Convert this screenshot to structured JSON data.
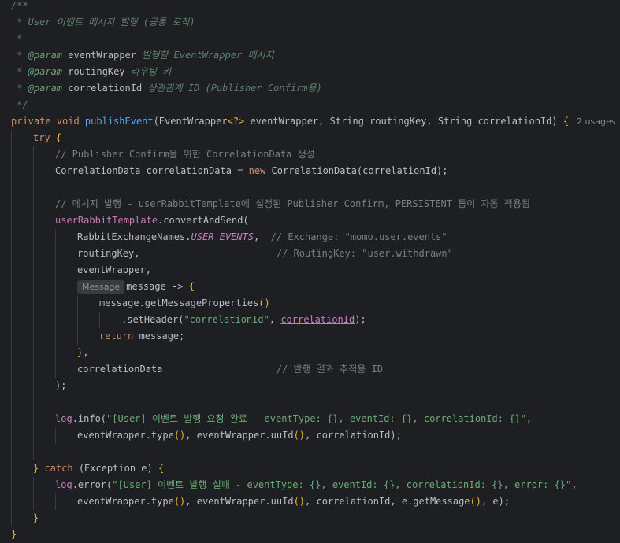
{
  "editor": {
    "usages_label": "2 usages",
    "param_hint": "Message",
    "lines": [
      {
        "indent": 0,
        "tokens": [
          {
            "t": "/**",
            "c": "doc"
          }
        ]
      },
      {
        "indent": 0,
        "tokens": [
          {
            "t": " * User 이벤트 메시지 발행 (공통 로직)",
            "c": "doc"
          }
        ]
      },
      {
        "indent": 0,
        "tokens": [
          {
            "t": " *",
            "c": "doc"
          }
        ]
      },
      {
        "indent": 0,
        "tokens": [
          {
            "t": " * ",
            "c": "doc"
          },
          {
            "t": "@param",
            "c": "doctag"
          },
          {
            "t": " ",
            "c": "doc"
          },
          {
            "t": "eventWrapper",
            "c": "plain"
          },
          {
            "t": " 발행할 EventWrapper 메시지",
            "c": "doc"
          }
        ]
      },
      {
        "indent": 0,
        "tokens": [
          {
            "t": " * ",
            "c": "doc"
          },
          {
            "t": "@param",
            "c": "doctag"
          },
          {
            "t": " ",
            "c": "doc"
          },
          {
            "t": "routingKey",
            "c": "plain"
          },
          {
            "t": " 라우팅 키",
            "c": "doc"
          }
        ]
      },
      {
        "indent": 0,
        "tokens": [
          {
            "t": " * ",
            "c": "doc"
          },
          {
            "t": "@param",
            "c": "doctag"
          },
          {
            "t": " ",
            "c": "doc"
          },
          {
            "t": "correlationId",
            "c": "plain"
          },
          {
            "t": " 상관관계 ID (Publisher Confirm용)",
            "c": "doc"
          }
        ]
      },
      {
        "indent": 0,
        "tokens": [
          {
            "t": " */",
            "c": "doc"
          }
        ]
      },
      {
        "indent": 0,
        "usages": true,
        "tokens": [
          {
            "t": "private void ",
            "c": "kw"
          },
          {
            "t": "publishEvent",
            "c": "fn"
          },
          {
            "t": "(EventWrapper",
            "c": "plain"
          },
          {
            "t": "<?>",
            "c": "bracket"
          },
          {
            "t": " eventWrapper, String routingKey, String correlationId) ",
            "c": "plain"
          },
          {
            "t": "{",
            "c": "bracket"
          }
        ]
      },
      {
        "indent": 1,
        "tokens": [
          {
            "t": "try ",
            "c": "kw"
          },
          {
            "t": "{",
            "c": "bracket"
          }
        ]
      },
      {
        "indent": 2,
        "tokens": [
          {
            "t": "// Publisher Confirm을 위한 CorrelationData 생성",
            "c": "com"
          }
        ]
      },
      {
        "indent": 2,
        "tokens": [
          {
            "t": "CorrelationData correlationData = ",
            "c": "plain"
          },
          {
            "t": "new ",
            "c": "kw"
          },
          {
            "t": "CorrelationData(correlationId);",
            "c": "plain"
          }
        ]
      },
      {
        "indent": 2,
        "tokens": []
      },
      {
        "indent": 2,
        "tokens": [
          {
            "t": "// 메시지 발행 - userRabbitTemplate에 설정된 Publisher Confirm, PERSISTENT 등이 자동 적용됨",
            "c": "com"
          }
        ]
      },
      {
        "indent": 2,
        "tokens": [
          {
            "t": "userRabbitTemplate",
            "c": "field"
          },
          {
            "t": ".convertAndSend(",
            "c": "plain"
          }
        ]
      },
      {
        "indent": 3,
        "tokens": [
          {
            "t": "RabbitExchangeNames.",
            "c": "plain"
          },
          {
            "t": "USER_EVENTS",
            "c": "static"
          },
          {
            "t": ",  ",
            "c": "plain"
          },
          {
            "t": "// Exchange: \"momo.user.events\"",
            "c": "com"
          }
        ]
      },
      {
        "indent": 3,
        "tokens": [
          {
            "t": "routingKey,                        ",
            "c": "plain"
          },
          {
            "t": "// RoutingKey: \"user.withdrawn\"",
            "c": "com"
          }
        ]
      },
      {
        "indent": 3,
        "tokens": [
          {
            "t": "eventWrapper,",
            "c": "plain"
          }
        ]
      },
      {
        "indent": 3,
        "hint": true,
        "tokens": [
          {
            "t": "message -> ",
            "c": "plain"
          },
          {
            "t": "{",
            "c": "bracket"
          }
        ]
      },
      {
        "indent": 4,
        "tokens": [
          {
            "t": "message.getMessageProperties",
            "c": "plain"
          },
          {
            "t": "()",
            "c": "bracket"
          }
        ]
      },
      {
        "indent": 5,
        "tokens": [
          {
            "t": ".setHeader(",
            "c": "plain"
          },
          {
            "t": "\"correlationId\"",
            "c": "str"
          },
          {
            "t": ", ",
            "c": "plain"
          },
          {
            "t": "correlationId",
            "c": "under"
          },
          {
            "t": ");",
            "c": "plain"
          }
        ]
      },
      {
        "indent": 4,
        "tokens": [
          {
            "t": "return ",
            "c": "kw"
          },
          {
            "t": "message;",
            "c": "plain"
          }
        ]
      },
      {
        "indent": 3,
        "tokens": [
          {
            "t": "}",
            "c": "bracket"
          },
          {
            "t": ",",
            "c": "plain"
          }
        ]
      },
      {
        "indent": 3,
        "tokens": [
          {
            "t": "correlationData                    ",
            "c": "plain"
          },
          {
            "t": "// 발행 결과 추적용 ID",
            "c": "com"
          }
        ]
      },
      {
        "indent": 2,
        "tokens": [
          {
            "t": ");",
            "c": "plain"
          }
        ]
      },
      {
        "indent": 2,
        "tokens": []
      },
      {
        "indent": 2,
        "tokens": [
          {
            "t": "log",
            "c": "field"
          },
          {
            "t": ".info(",
            "c": "plain"
          },
          {
            "t": "\"[User] 이벤트 발행 요청 완료 - eventType: {}, eventId: {}, correlationId: {}\"",
            "c": "str"
          },
          {
            "t": ",",
            "c": "plain"
          }
        ]
      },
      {
        "indent": 3,
        "tokens": [
          {
            "t": "eventWrapper.type",
            "c": "plain"
          },
          {
            "t": "()",
            "c": "bracket"
          },
          {
            "t": ", eventWrapper.uuId",
            "c": "plain"
          },
          {
            "t": "()",
            "c": "bracket"
          },
          {
            "t": ", correlationId);",
            "c": "plain"
          }
        ]
      },
      {
        "indent": 2,
        "tokens": []
      },
      {
        "indent": 1,
        "tokens": [
          {
            "t": "} ",
            "c": "bracket"
          },
          {
            "t": "catch ",
            "c": "kw"
          },
          {
            "t": "(Exception e) ",
            "c": "plain"
          },
          {
            "t": "{",
            "c": "bracket"
          }
        ]
      },
      {
        "indent": 2,
        "tokens": [
          {
            "t": "log",
            "c": "field"
          },
          {
            "t": ".error(",
            "c": "plain"
          },
          {
            "t": "\"[User] 이벤트 발행 실패 - eventType: {}, eventId: {}, correlationId: {}, error: {}\"",
            "c": "str"
          },
          {
            "t": ",",
            "c": "plain"
          }
        ]
      },
      {
        "indent": 3,
        "tokens": [
          {
            "t": "eventWrapper.type",
            "c": "plain"
          },
          {
            "t": "()",
            "c": "bracket"
          },
          {
            "t": ", eventWrapper.uuId",
            "c": "plain"
          },
          {
            "t": "()",
            "c": "bracket"
          },
          {
            "t": ", correlationId, e.getMessage",
            "c": "plain"
          },
          {
            "t": "()",
            "c": "bracket"
          },
          {
            "t": ", e);",
            "c": "plain"
          }
        ]
      },
      {
        "indent": 1,
        "tokens": [
          {
            "t": "}",
            "c": "bracket"
          }
        ]
      },
      {
        "indent": 0,
        "tokens": [
          {
            "t": "}",
            "c": "bracket"
          }
        ]
      }
    ]
  }
}
